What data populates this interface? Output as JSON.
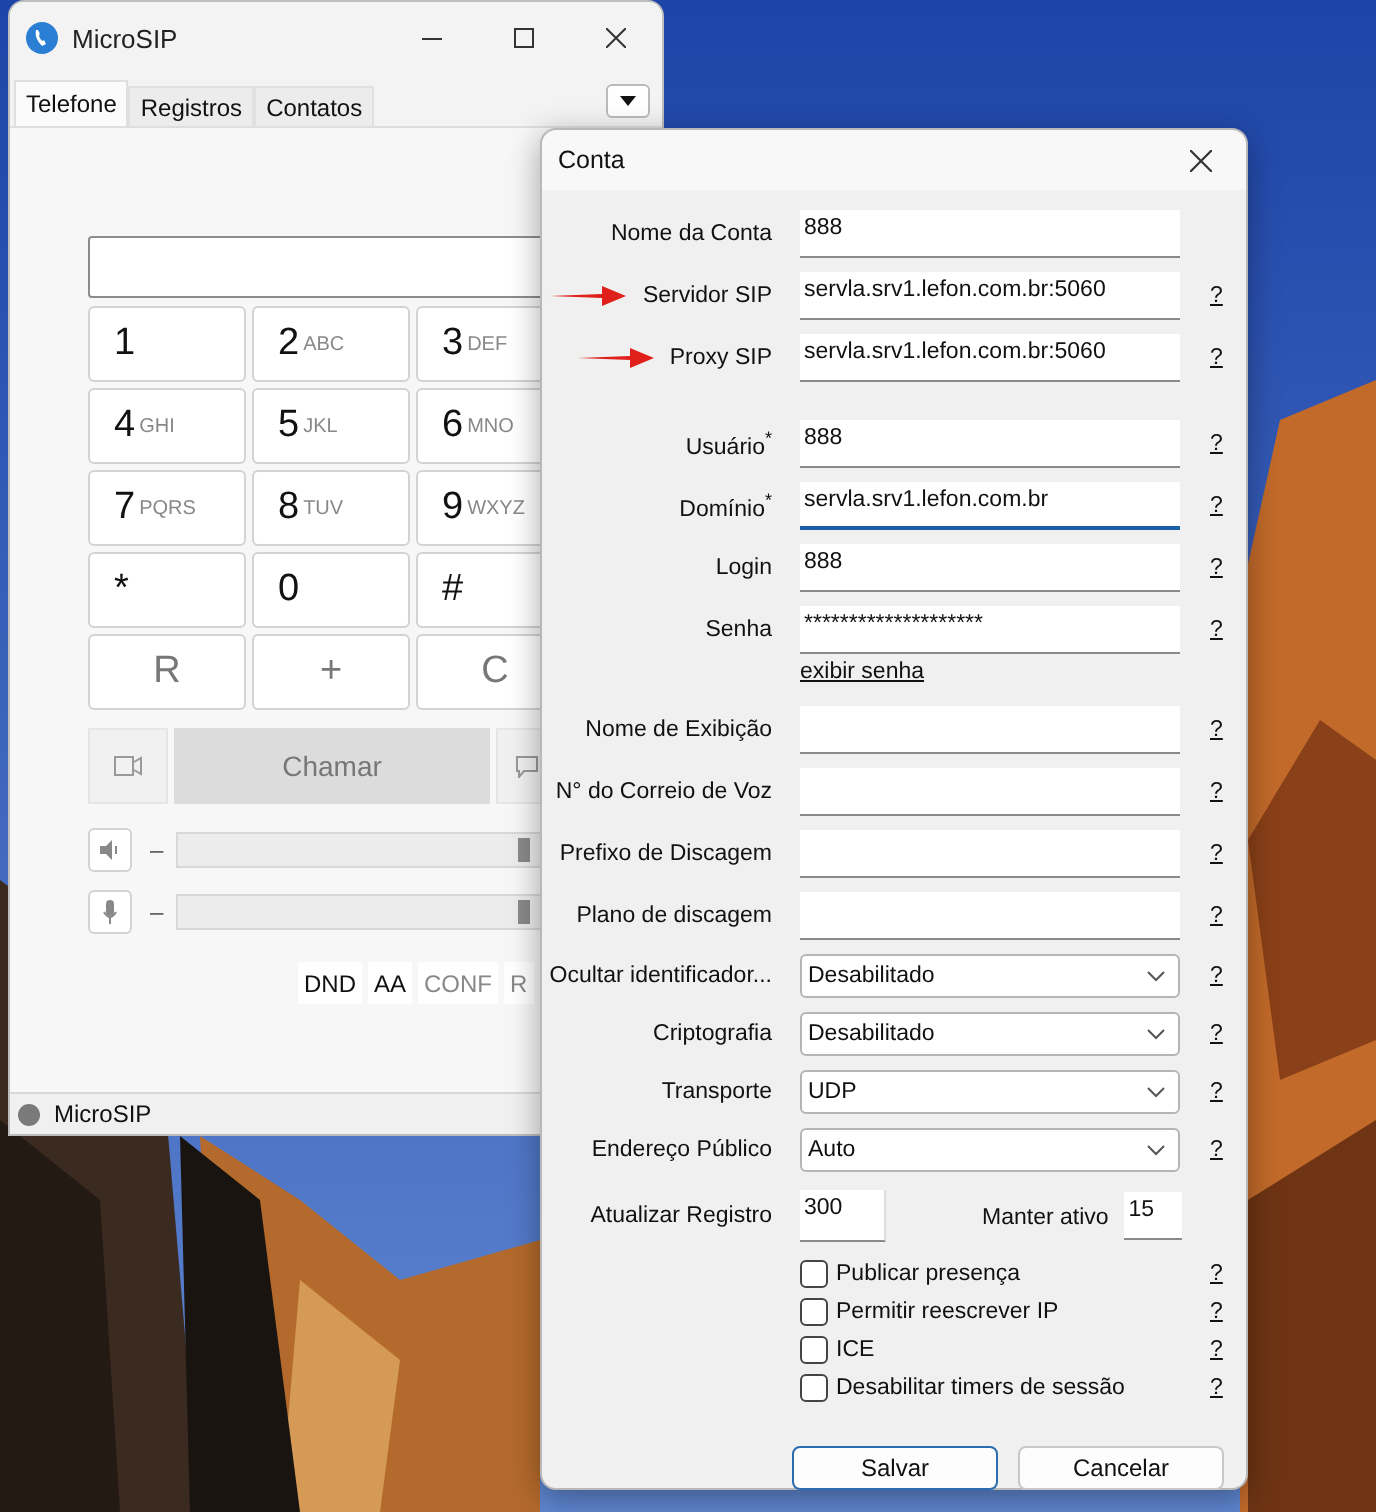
{
  "main_window": {
    "title": "MicroSIP",
    "tabs": [
      {
        "label": "Telefone",
        "selected": true
      },
      {
        "label": "Registros",
        "selected": false
      },
      {
        "label": "Contatos",
        "selected": false
      }
    ],
    "keypad": [
      {
        "kind": "digit",
        "key": "1"
      },
      {
        "kind": "digit",
        "key": "2",
        "letters": "ABC"
      },
      {
        "kind": "digit",
        "key": "3",
        "letters": "DEF"
      },
      {
        "kind": "digit",
        "key": "4",
        "letters": "GHI"
      },
      {
        "kind": "digit",
        "key": "5",
        "letters": "JKL"
      },
      {
        "kind": "digit",
        "key": "6",
        "letters": "MNO"
      },
      {
        "kind": "digit",
        "key": "7",
        "letters": "PQRS"
      },
      {
        "kind": "digit",
        "key": "8",
        "letters": "TUV"
      },
      {
        "kind": "digit",
        "key": "9",
        "letters": "WXYZ"
      },
      {
        "kind": "digit",
        "key": "*"
      },
      {
        "kind": "digit",
        "key": "0"
      },
      {
        "kind": "digit",
        "key": "#"
      },
      {
        "kind": "action",
        "key": "R"
      },
      {
        "kind": "action",
        "key": "+"
      },
      {
        "kind": "action",
        "key": "C"
      }
    ],
    "call_button": "Chamar",
    "sliders": [
      {
        "kind": "speaker",
        "sign": "–",
        "level": 0.88
      },
      {
        "kind": "microphone",
        "sign": "–",
        "level": 0.88
      }
    ],
    "feature_buttons": [
      {
        "label": "DND",
        "disabled": false
      },
      {
        "label": "AA",
        "disabled": false
      },
      {
        "label": "CONF",
        "disabled": true
      },
      {
        "label": "R",
        "disabled": true
      }
    ],
    "status": {
      "text": "MicroSIP",
      "color": "#7a7a7a"
    }
  },
  "dialog": {
    "title": "Conta",
    "fields": [
      {
        "kind": "text",
        "label": "Nome da Conta",
        "value": "888",
        "marked": false,
        "focused": false
      },
      {
        "kind": "text",
        "label": "Servidor SIP",
        "value": "servla.srv1.lefon.com.br:5060",
        "help": "?",
        "marked": true,
        "focused": false
      },
      {
        "kind": "text",
        "label": "Proxy SIP",
        "value": "servla.srv1.lefon.com.br:5060",
        "help": "?",
        "marked": true,
        "focused": false
      },
      {
        "kind": "text",
        "label": "Usuário$^{*}$",
        "value": "888",
        "help": "?",
        "marked": false,
        "focused": false
      },
      {
        "kind": "text",
        "label": "Domínio$^{*}$",
        "value": "servla.srv1.lefon.com.br",
        "help": "?",
        "marked": false,
        "focused": true
      },
      {
        "kind": "text",
        "label": "Login",
        "value": "888",
        "help": "?",
        "marked": false,
        "focused": false
      },
      {
        "kind": "text",
        "label": "Senha",
        "value": "********************",
        "help": "?",
        "marked": false,
        "focused": false,
        "link": "exibir senha"
      },
      {
        "kind": "text",
        "label": "Nome de Exibição",
        "help": "?",
        "marked": false,
        "focused": false
      },
      {
        "kind": "text",
        "label": "N° do Correio de Voz",
        "help": "?",
        "marked": false,
        "focused": false
      },
      {
        "kind": "text",
        "label": "Prefixo de Discagem",
        "help": "?",
        "marked": false,
        "focused": false
      },
      {
        "kind": "text",
        "label": "Plano de discagem",
        "help": "?",
        "marked": false,
        "focused": false
      },
      {
        "kind": "select",
        "label": "Ocultar identificador...",
        "value": "Desabilitado",
        "help": "?",
        "marked": false,
        "focused": false
      },
      {
        "kind": "select",
        "label": "Criptografia",
        "value": "Desabilitado",
        "help": "?",
        "marked": false,
        "focused": false
      },
      {
        "kind": "select",
        "label": "Transporte",
        "value": "UDP",
        "help": "?",
        "marked": false,
        "focused": false
      },
      {
        "kind": "select",
        "label": "Endereço Público",
        "value": "Auto",
        "help": "?",
        "marked": false,
        "focused": false
      }
    ],
    "refresh": {
      "label": "Atualizar Registro",
      "value": "300"
    },
    "keepalive": {
      "label": "Manter ativo",
      "value": "15"
    },
    "checkboxes": [
      {
        "label": "Publicar presença",
        "checked": false,
        "help": "?"
      },
      {
        "label": "Permitir reescrever IP",
        "checked": false,
        "help": "?"
      },
      {
        "label": "ICE",
        "checked": false,
        "help": "?"
      },
      {
        "label": "Desabilitar timers de sessão",
        "checked": false,
        "help": "?"
      }
    ],
    "buttons": [
      {
        "label": "Salvar",
        "default": true
      },
      {
        "label": "Cancelar",
        "default": false
      }
    ]
  }
}
